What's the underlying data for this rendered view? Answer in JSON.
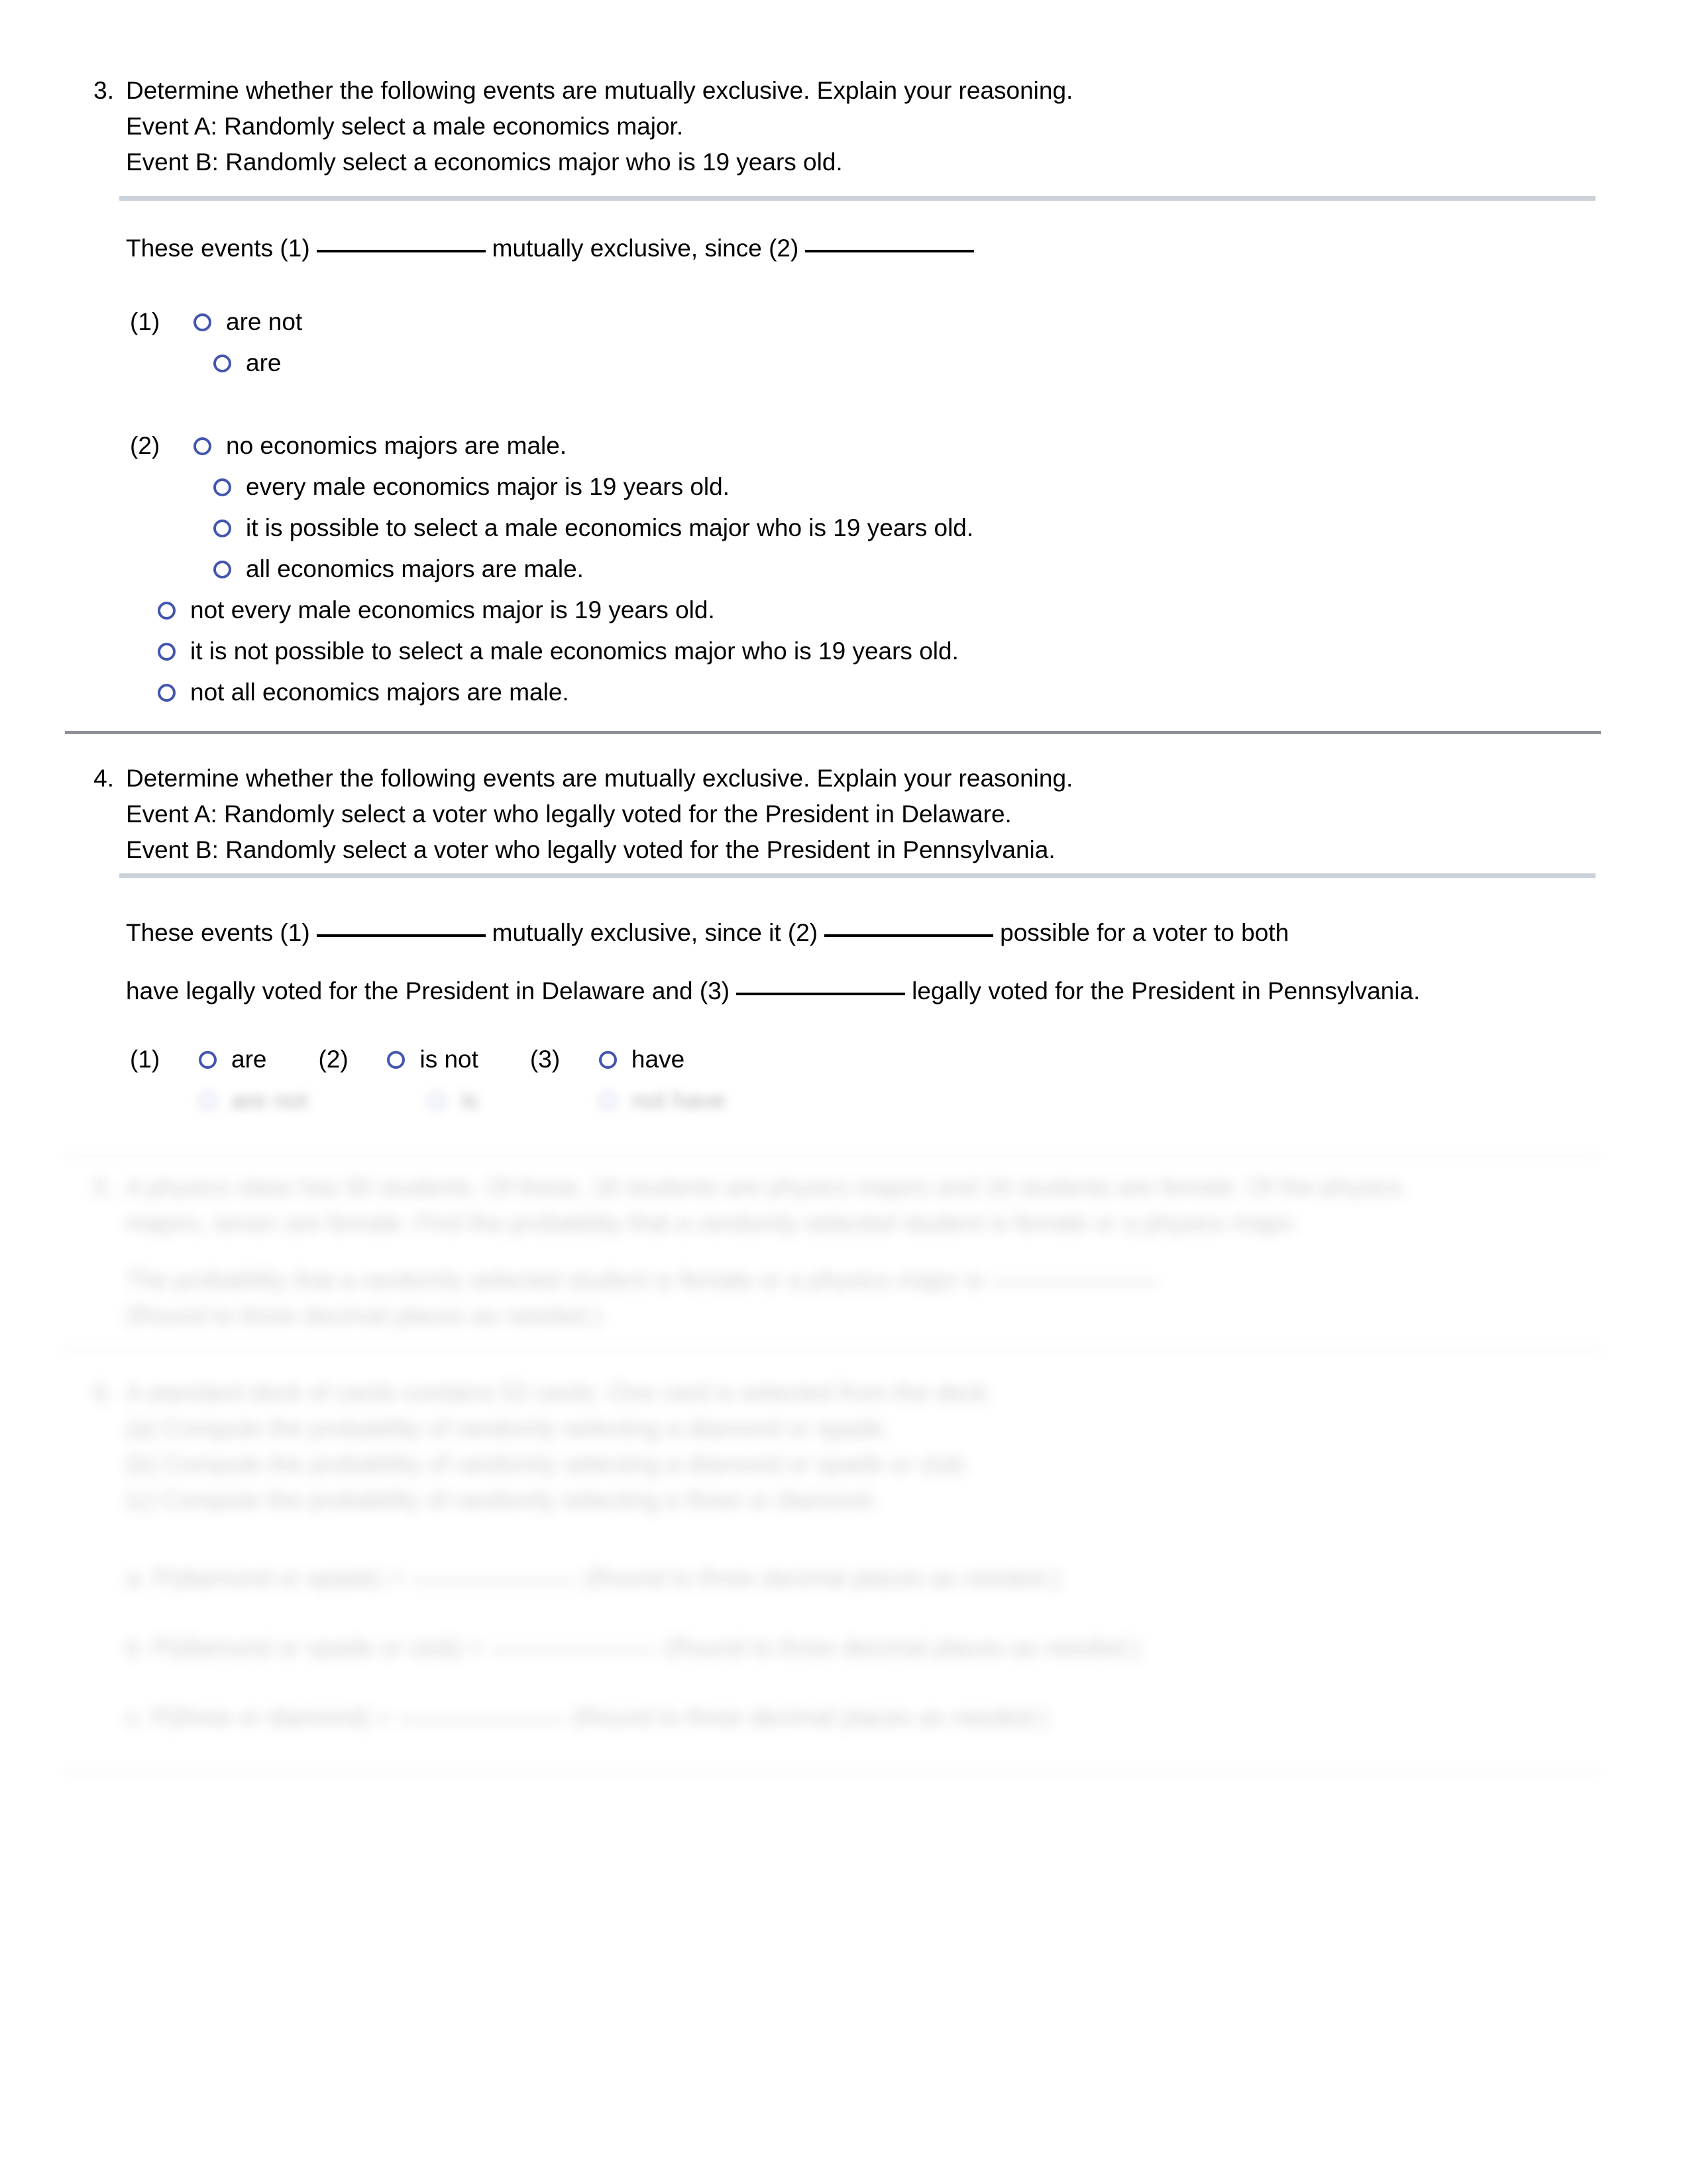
{
  "question3": {
    "number": "3.",
    "prompt": "Determine whether the following events are mutually exclusive. Explain your reasoning.",
    "event_a": "Event A: Randomly select a male economics major.",
    "event_b": "Event B: Randomly select a economics major who is 19 years old.",
    "statement": {
      "part1": "These events",
      "tag1": "(1)",
      "part2": "mutually exclusive, since",
      "tag2": "(2)"
    },
    "group1": {
      "tag": "(1)",
      "options": [
        {
          "label": "are not",
          "selected": false
        },
        {
          "label": "are",
          "selected": false
        }
      ]
    },
    "group2": {
      "tag": "(2)",
      "options": [
        {
          "label": "no economics majors are male.",
          "selected": false,
          "indent": "normal"
        },
        {
          "label": "every male economics major is 19 years old.",
          "selected": false,
          "indent": "normal"
        },
        {
          "label": "it is possible to select a male economics major who is 19 years old.",
          "selected": false,
          "indent": "normal"
        },
        {
          "label": "all economics majors are male.",
          "selected": false,
          "indent": "normal"
        },
        {
          "label": "not every male economics major is 19 years old.",
          "selected": false,
          "indent": "outdent"
        },
        {
          "label": "it is not possible to select a male economics major who is 19 years old.",
          "selected": false,
          "indent": "outdent"
        },
        {
          "label": "not all economics majors are male.",
          "selected": false,
          "indent": "outdent"
        }
      ]
    }
  },
  "question4": {
    "number": "4.",
    "prompt": "Determine whether the following events are mutually exclusive. Explain your reasoning.",
    "event_a": "Event A: Randomly select a voter who legally voted for the President in Delaware.",
    "event_b": "Event B: Randomly select a voter who legally voted for the President in Pennsylvania.",
    "statement": {
      "line1_part1": "These events",
      "line1_tag1": "(1)",
      "line1_part2": "mutually exclusive, since it",
      "line1_tag2": "(2)",
      "line1_part3": "possible for a voter to both",
      "line2_part1": "have legally voted for the President in Delaware and",
      "line2_tag3": "(3)",
      "line2_part2": "legally voted for the President in Pennsylvania."
    },
    "choices": [
      {
        "tag": "(1)",
        "label": "are",
        "selected": false
      },
      {
        "tag": "(2)",
        "label": "is not",
        "selected": false
      },
      {
        "tag": "(3)",
        "label": "have",
        "selected": false
      }
    ],
    "choices_row2": [
      {
        "tag": "",
        "label": "are not",
        "selected": false
      },
      {
        "tag": "",
        "label": "is",
        "selected": false
      },
      {
        "tag": "",
        "label": "not have",
        "selected": false
      }
    ]
  },
  "question5": {
    "number": "5.",
    "line1": "A physics class has 50 students. Of these, 18 students are physics majors and 16 students are female. Of the physics",
    "line2": "majors, seven are female. Find the probability that a randomly selected student is female or a physics major.",
    "answer_line1": "The probability that a randomly selected student is female or a physics major is",
    "answer_line2": "(Round to three decimal places as needed.)"
  },
  "question6": {
    "number": "6.",
    "line1": "A standard deck of cards contains 52 cards. One card is selected from the deck.",
    "line2": "(a) Compute the probability of randomly selecting a diamond or spade.",
    "line3": "(b) Compute the probability of randomly selecting a diamond or spade or club.",
    "line4": "(c) Compute the probability of randomly selecting a three or diamond.",
    "answer_a_label": "a. P(diamond or spade) =",
    "answer_a_note": "(Round to three decimal places as needed.)",
    "answer_b_label": "b. P(diamond or spade or club) =",
    "answer_b_note": "(Round to three decimal places as needed.)",
    "answer_c_label": "c. P(three or diamond) =",
    "answer_c_note": "(Round to three decimal places as needed.)"
  },
  "colors": {
    "radio_outline": "#4356ae",
    "divider_light": "#ccd2da",
    "divider_strong": "#8e9196",
    "text": "#000000"
  }
}
